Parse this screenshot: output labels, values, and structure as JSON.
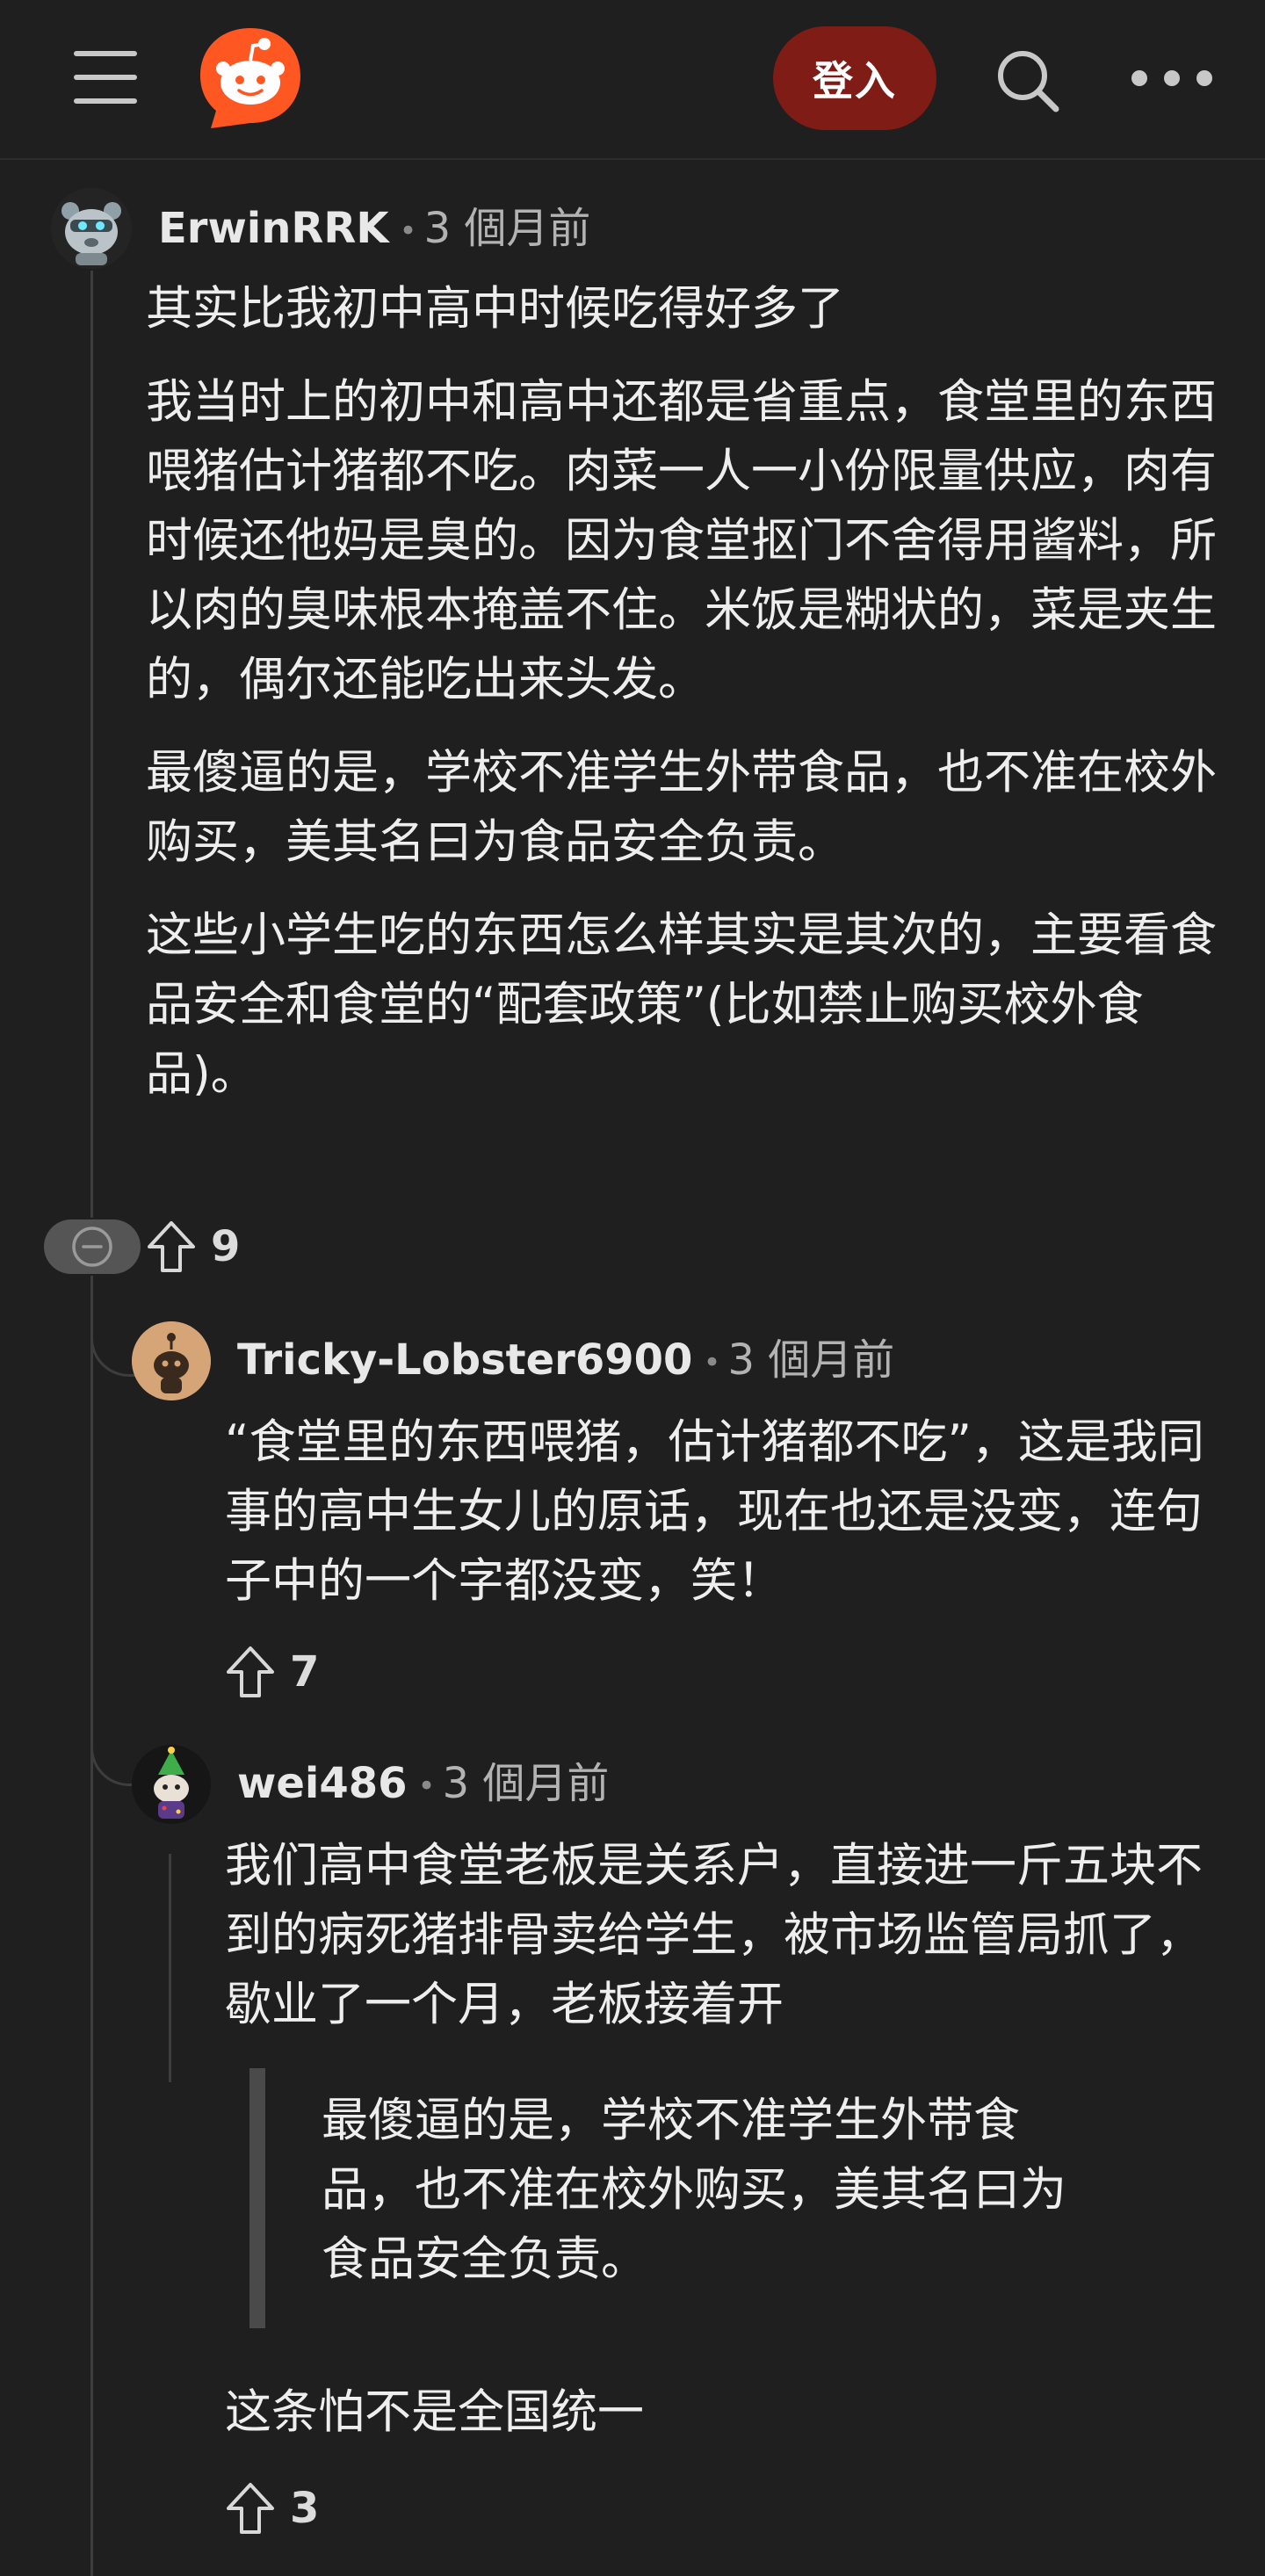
{
  "header": {
    "login_label": "登入",
    "icons": {
      "menu": "hamburger-icon",
      "logo": "reddit-logo-icon",
      "search": "search-icon",
      "more": "more-horizontal-icon"
    },
    "colors": {
      "login_bg": "#7f1c15",
      "logo_bg": "#ff5722"
    }
  },
  "comments": [
    {
      "username": "ErwinRRK",
      "time": "3 個月前",
      "paragraphs": [
        "其实比我初中高中时候吃得好多了",
        "我当时上的初中和高中还都是省重点，食堂里的东西喂猪估计猪都不吃。肉菜一人一小份限量供应，肉有时候还他妈是臭的。因为食堂抠门不舍得用酱料，所以肉的臭味根本掩盖不住。米饭是糊状的，菜是夹生的，偶尔还能吃出来头发。",
        "最傻逼的是，学校不准学生外带食品，也不准在校外购买，美其名曰为食品安全负责。",
        "这些小学生吃的东西怎么样其实是其次的，主要看食品安全和食堂的“配套政策”(比如禁止购买校外食品)。"
      ],
      "votes": "9"
    },
    {
      "username": "Tricky-Lobster6900",
      "time": "3 個月前",
      "paragraphs": [
        "“食堂里的东西喂猪，估计猪都不吃”，这是我同事的高中生女儿的原话，现在也还是没变，连句子中的一个字都没变，笑！"
      ],
      "votes": "7"
    },
    {
      "username": "wei486",
      "time": "3 個月前",
      "paragraphs": [
        "我们高中食堂老板是关系户，直接进一斤五块不到的病死猪排骨卖给学生，被市场监管局抓了，歇业了一个月，老板接着开"
      ],
      "quote": "最傻逼的是，学校不准学生外带食品，也不准在校外购买，美其名曰为食品安全负责。",
      "after_quote": "这条怕不是全国统一",
      "votes": "3"
    }
  ]
}
